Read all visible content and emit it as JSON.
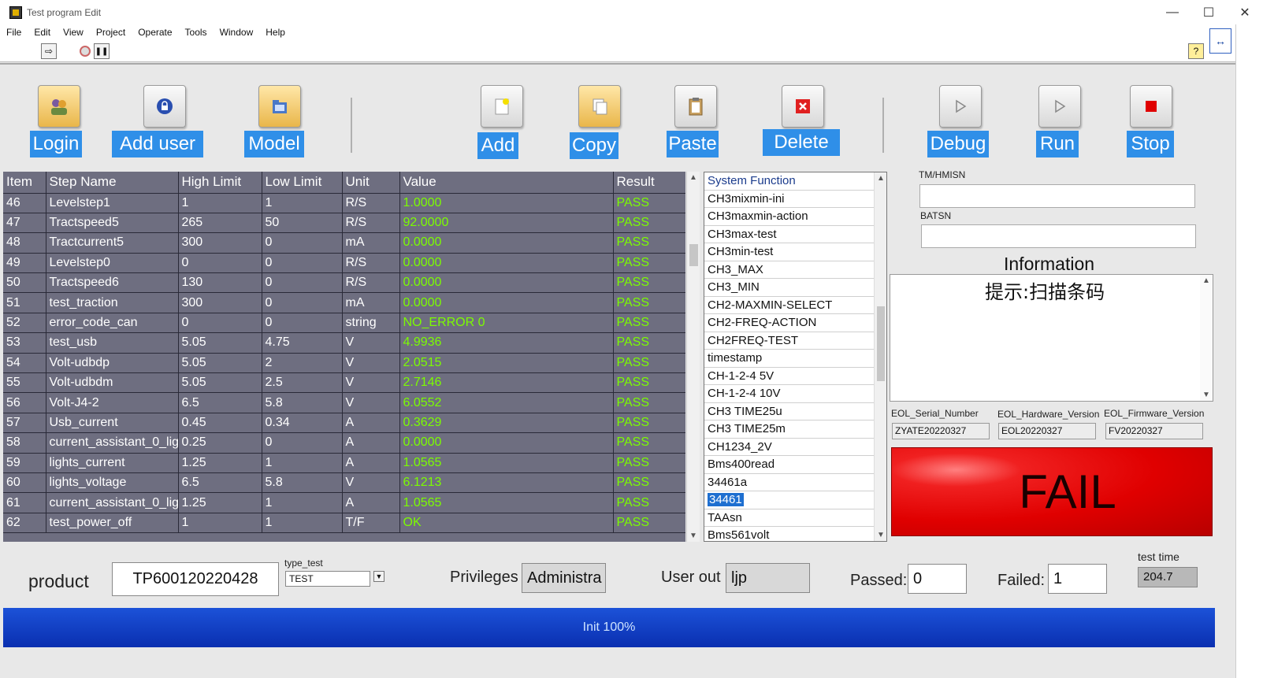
{
  "window": {
    "title": "Test program Edit",
    "minimize": "—",
    "maximize": "☐",
    "close": "✕"
  },
  "menu": [
    "File",
    "Edit",
    "View",
    "Project",
    "Operate",
    "Tools",
    "Window",
    "Help"
  ],
  "toolbar": {
    "run_arrow": "⇨",
    "pause": "❚❚",
    "help": "?",
    "context": "↔"
  },
  "buttons": {
    "login": "Login",
    "add_user": "Add user",
    "model": "Model",
    "add": "Add",
    "copy": "Copy",
    "paste": "Paste",
    "delete": "Delete",
    "debug": "Debug",
    "run": "Run",
    "stop": "Stop"
  },
  "table": {
    "headers": [
      "Item",
      "Step Name",
      "High Limit",
      "Low Limit",
      "Unit",
      "Value",
      "Result"
    ],
    "rows": [
      [
        "46",
        "Levelstep1",
        "1",
        "1",
        "R/S",
        "1.0000",
        "PASS"
      ],
      [
        "47",
        "Tractspeed5",
        "265",
        "50",
        "R/S",
        "92.0000",
        "PASS"
      ],
      [
        "48",
        "Tractcurrent5",
        "300",
        "0",
        "mA",
        "0.0000",
        "PASS"
      ],
      [
        "49",
        "Levelstep0",
        "0",
        "0",
        "R/S",
        "0.0000",
        "PASS"
      ],
      [
        "50",
        "Tractspeed6",
        "130",
        "0",
        "R/S",
        "0.0000",
        "PASS"
      ],
      [
        "51",
        "test_traction",
        "300",
        "0",
        "mA",
        "0.0000",
        "PASS"
      ],
      [
        "52",
        "error_code_can",
        "0",
        "0",
        "string",
        "NO_ERROR 0",
        "PASS"
      ],
      [
        "53",
        "test_usb",
        "5.05",
        "4.75",
        "V",
        "4.9936",
        "PASS"
      ],
      [
        "54",
        "Volt-udbdp",
        "5.05",
        "2",
        "V",
        "2.0515",
        "PASS"
      ],
      [
        "55",
        "Volt-udbdm",
        "5.05",
        "2.5",
        "V",
        "2.7146",
        "PASS"
      ],
      [
        "56",
        "Volt-J4-2",
        "6.5",
        "5.8",
        "V",
        "6.0552",
        "PASS"
      ],
      [
        "57",
        "Usb_current",
        "0.45",
        "0.34",
        "A",
        "0.3629",
        "PASS"
      ],
      [
        "58",
        "current_assistant_0_lig",
        "0.25",
        "0",
        "A",
        "0.0000",
        "PASS"
      ],
      [
        "59",
        "lights_current",
        "1.25",
        "1",
        "A",
        "1.0565",
        "PASS"
      ],
      [
        "60",
        "lights_voltage",
        "6.5",
        "5.8",
        "V",
        "6.1213",
        "PASS"
      ],
      [
        "61",
        "current_assistant_0_lig",
        "1.25",
        "1",
        "A",
        "1.0565",
        "PASS"
      ],
      [
        "62",
        "test_power_off",
        "1",
        "1",
        "T/F",
        "OK",
        "PASS"
      ]
    ]
  },
  "functions": {
    "header": "System Function",
    "items": [
      "CH3mixmin-ini",
      "CH3maxmin-action",
      "CH3max-test",
      "CH3min-test",
      "CH3_MAX",
      "CH3_MIN",
      "CH2-MAXMIN-SELECT",
      "CH2-FREQ-ACTION",
      "CH2FREQ-TEST",
      "timestamp",
      "CH-1-2-4 5V",
      "CH-1-2-4 10V",
      "CH3 TIME25u",
      "CH3 TIME25m",
      "CH1234_2V",
      "Bms400read",
      "34461a",
      "34461",
      "TAAsn",
      "Bms561volt"
    ],
    "selected": "34461"
  },
  "right": {
    "tm_label": "TM/HMISN",
    "tm_value": "",
    "batsn_label": "BATSN",
    "batsn_value": "",
    "info_title": "Information",
    "info_text": "提示:扫描条码",
    "serial_label": "EOL_Serial_Number",
    "serial_value": "ZYATE20220327",
    "hw_label": "EOL_Hardware_Version",
    "hw_value": "EOL20220327",
    "fw_label": "EOL_Firmware_Version",
    "fw_value": "FV20220327",
    "result": "FAIL"
  },
  "bottom": {
    "product_label": "product",
    "product_value": "TP600120220428",
    "type_label": "type_test",
    "type_value": "TEST",
    "privileges_label": "Privileges",
    "privileges_value": "Administra",
    "user_out_label": "User out",
    "user_out_value": "ljp",
    "passed_label": "Passed:",
    "passed_value": "0",
    "failed_label": "Failed:",
    "failed_value": "1",
    "test_time_label": "test time",
    "test_time_value": "204.7"
  },
  "progress": {
    "text": "Init 100%",
    "fraction": 1.0
  },
  "colors": {
    "button_label_bg": "#2f8fe8",
    "table_bg": "#6e6e80",
    "value_green": "#7cfc00",
    "fail_red": "#e00000",
    "progress_blue": "#1c52d8"
  }
}
